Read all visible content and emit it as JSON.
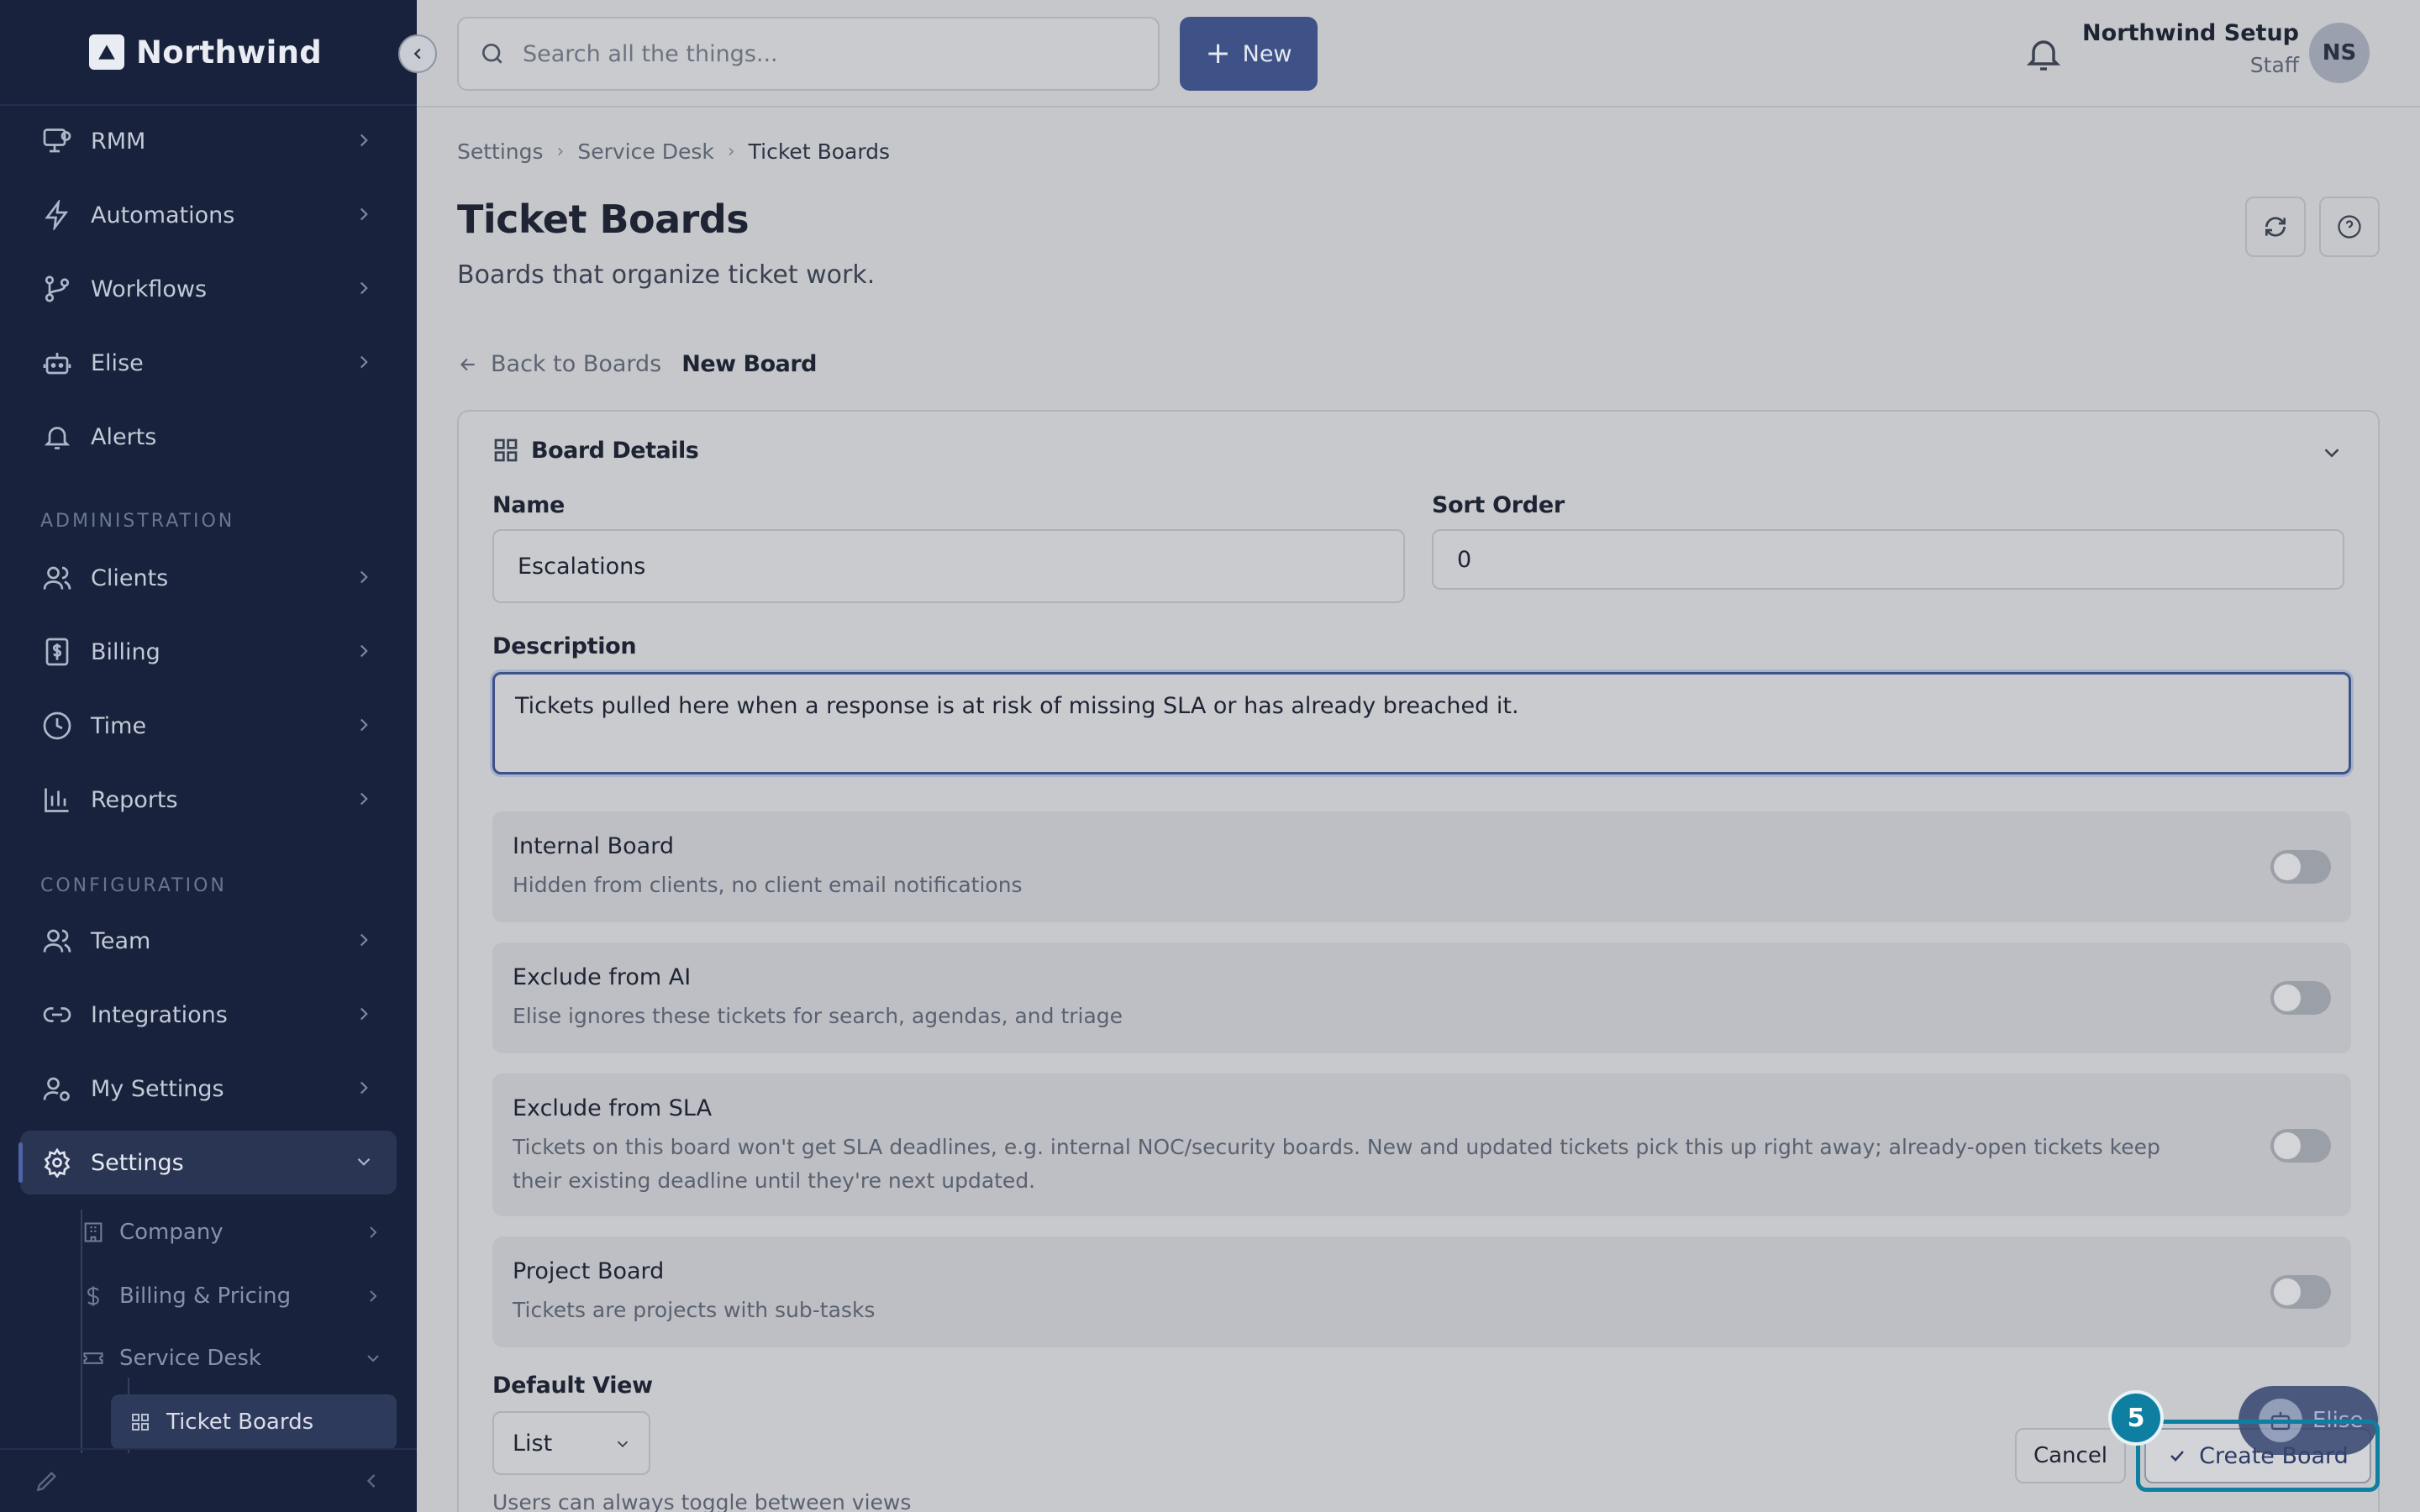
{
  "brand": {
    "name": "Northwind"
  },
  "sidebar": {
    "items": [
      {
        "label": "RMM",
        "icon": "monitor-icon"
      },
      {
        "label": "Automations",
        "icon": "bolt-icon"
      },
      {
        "label": "Workflows",
        "icon": "git-branch-icon"
      },
      {
        "label": "Elise",
        "icon": "robot-icon"
      },
      {
        "label": "Alerts",
        "icon": "bell-icon"
      }
    ],
    "section_admin": "ADMINISTRATION",
    "admin_items": [
      {
        "label": "Clients",
        "icon": "users-icon"
      },
      {
        "label": "Billing",
        "icon": "dollar-doc-icon"
      },
      {
        "label": "Time",
        "icon": "clock-icon"
      },
      {
        "label": "Reports",
        "icon": "bar-chart-icon"
      }
    ],
    "section_config": "CONFIGURATION",
    "config_items": [
      {
        "label": "Team",
        "icon": "users-icon"
      },
      {
        "label": "Integrations",
        "icon": "link-icon"
      },
      {
        "label": "My Settings",
        "icon": "user-gear-icon"
      },
      {
        "label": "Settings",
        "icon": "gear-icon"
      }
    ],
    "sub_items": [
      {
        "label": "Company",
        "icon": "building-icon"
      },
      {
        "label": "Billing & Pricing",
        "icon": "dollar-icon"
      },
      {
        "label": "Service Desk",
        "icon": "ticket-icon"
      },
      {
        "label": "Ticket Boards",
        "icon": "grid-icon"
      }
    ]
  },
  "topbar": {
    "search_placeholder": "Search all the things...",
    "new_label": "New",
    "user_name": "Northwind Setup",
    "user_role": "Staff",
    "avatar_initials": "NS"
  },
  "breadcrumb": [
    "Settings",
    "Service Desk",
    "Ticket Boards"
  ],
  "page": {
    "title": "Ticket Boards",
    "subtitle": "Boards that organize ticket work.",
    "back_label": "Back to Boards",
    "current_label": "New Board"
  },
  "form": {
    "section_title": "Board Details",
    "name_label": "Name",
    "name_value": "Escalations",
    "sort_label": "Sort Order",
    "sort_value": "0",
    "description_label": "Description",
    "description_value": "Tickets pulled here when a response is at risk of missing SLA or has already breached it.",
    "toggles": [
      {
        "title": "Internal Board",
        "desc": "Hidden from clients, no client email notifications"
      },
      {
        "title": "Exclude from AI",
        "desc": "Elise ignores these tickets for search, agendas, and triage"
      },
      {
        "title": "Exclude from SLA",
        "desc": "Tickets on this board won't get SLA deadlines, e.g. internal NOC/security boards. New and updated tickets pick this up right away; already-open tickets keep their existing deadline until they're next updated."
      },
      {
        "title": "Project Board",
        "desc": "Tickets are projects with sub-tasks"
      }
    ],
    "default_view_label": "Default View",
    "default_view_value": "List",
    "helper": "Users can always toggle between views"
  },
  "actions": {
    "cancel": "Cancel",
    "create": "Create Board",
    "step": "5",
    "elise_fab": "Elise"
  },
  "colors": {
    "sidebar_bg": "#18223c",
    "accent": "#3e5288",
    "highlight": "#0e7fa0"
  }
}
